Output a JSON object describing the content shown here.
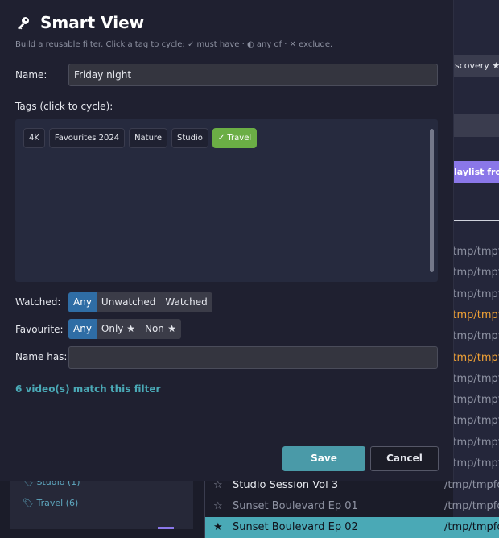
{
  "background": {
    "discovery_label": "scovery ★",
    "purple_button_label": "laylist from",
    "paths": [
      {
        "text": "/tmp/tmpfo",
        "highlight": false
      },
      {
        "text": "/tmp/tmpfo",
        "highlight": false
      },
      {
        "text": "/tmp/tmpfo",
        "highlight": false
      },
      {
        "text": "/tmp/tmpfo",
        "highlight": true
      },
      {
        "text": "/tmp/tmpfo",
        "highlight": false
      },
      {
        "text": "/tmp/tmpfo",
        "highlight": true
      },
      {
        "text": "/tmp/tmpfo",
        "highlight": false
      },
      {
        "text": "/tmp/tmpfo",
        "highlight": false
      },
      {
        "text": "/tmp/tmpfo",
        "highlight": false
      },
      {
        "text": "/tmp/tmpfo",
        "highlight": false
      },
      {
        "text": "/tmp/tmpfo",
        "highlight": false
      }
    ],
    "sidebar_tag_partial": "🏷 Studio (1)",
    "sidebar_tag_travel": "🏷 Travel  (6)",
    "rows": [
      {
        "star": "☆",
        "title": "Studio Session Vol 3",
        "path": "/tmp/tmpfo"
      },
      {
        "star": "☆",
        "title": "Sunset Boulevard Ep 01",
        "path": "/tmp/tmpfo"
      },
      {
        "star": "★",
        "title": "Sunset Boulevard Ep 02",
        "path": "/tmp/tmpfo"
      }
    ]
  },
  "dialog": {
    "title": "Smart View",
    "icon": "key-icon",
    "subtitle": "Build a reusable filter. Click a tag to cycle: ✓ must have · ◐ any of · ✕ exclude.",
    "name_label": "Name:",
    "name_value": "Friday night",
    "tags_label": "Tags (click to cycle):",
    "tags": [
      {
        "label": "4K",
        "state": "neutral"
      },
      {
        "label": "Favourites 2024",
        "state": "neutral"
      },
      {
        "label": "Nature",
        "state": "neutral"
      },
      {
        "label": "Studio",
        "state": "neutral"
      },
      {
        "label": "✓ Travel",
        "state": "must"
      }
    ],
    "watched_label": "Watched:",
    "watched_options": [
      "Any",
      "Unwatched",
      "Watched"
    ],
    "watched_selected": "Any",
    "favourite_label": "Favourite:",
    "favourite_options": [
      "Any",
      "Only ★",
      "Non-★"
    ],
    "favourite_selected": "Any",
    "name_has_label": "Name has:",
    "name_has_value": "",
    "match_text": "6 video(s) match this filter",
    "save_label": "Save",
    "cancel_label": "Cancel"
  },
  "colors": {
    "accent_teal": "#4aa9b6",
    "segment_active": "#2f6da5",
    "tag_must": "#6bae45",
    "purple": "#8a77e9",
    "orange_path": "#f0a135"
  }
}
